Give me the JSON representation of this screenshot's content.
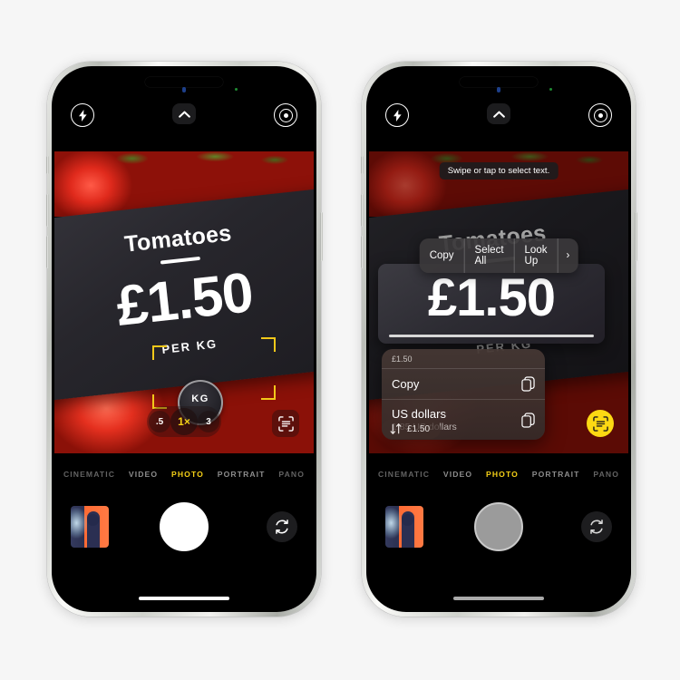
{
  "background_color": "#f6f6f6",
  "accent_yellow": "#f6d117",
  "scan_highlight_color": "#fcd913",
  "bracket_color": "#f2c81a",
  "phones": [
    {
      "id": "left",
      "label": "iphone-camera-live-text",
      "camera_controls": {
        "flash_icon": "flash-icon",
        "chevron_icon": "chevron-up-icon",
        "live_photo_icon": "live-photo-icon"
      },
      "sign": {
        "title": "Tomatoes",
        "price": "£1.50",
        "unit": "PER KG",
        "loupe_text": "KG"
      },
      "zoom_levels": [
        {
          "label": ".5",
          "selected": false
        },
        {
          "label": "1×",
          "selected": true
        },
        {
          "label": "3",
          "selected": false
        }
      ],
      "scan_button": {
        "icon": "live-text-scan-icon",
        "highlighted": false
      },
      "modes": [
        {
          "label": "CINEMATIC",
          "active": false,
          "edge": true
        },
        {
          "label": "VIDEO",
          "active": false,
          "edge": false
        },
        {
          "label": "PHOTO",
          "active": true,
          "edge": false
        },
        {
          "label": "PORTRAIT",
          "active": false,
          "edge": false
        },
        {
          "label": "PANO",
          "active": false,
          "edge": true
        }
      ],
      "shutter": {
        "name": "shutter-button",
        "dimmed": false
      },
      "flip_icon": "camera-flip-icon",
      "thumbnail": "photo-library-thumbnail"
    },
    {
      "id": "right",
      "label": "iphone-live-text-selection",
      "camera_controls": {
        "flash_icon": "flash-icon",
        "chevron_icon": "chevron-up-icon",
        "live_photo_icon": "live-photo-icon"
      },
      "sign": {
        "title": "Tomatoes",
        "price": "£1.50",
        "unit": "PER KG"
      },
      "tooltip": "Swipe or tap to select text.",
      "edit_menu": [
        {
          "label": "Copy"
        },
        {
          "label": "Select All"
        },
        {
          "label": "Look Up"
        },
        {
          "label": "›"
        }
      ],
      "magnifier": {
        "text": "£1.50"
      },
      "context_menu": {
        "header": "£1.50",
        "items": [
          {
            "title": "Copy",
            "subtitle": "",
            "icon": "copy-icon"
          },
          {
            "title": "US dollars",
            "subtitle": "1.85 US dollars",
            "icon": "copy-icon"
          }
        ]
      },
      "conversion_pill": {
        "icon": "convert-arrows-icon",
        "label": "£1.50"
      },
      "scan_button": {
        "icon": "live-text-scan-icon",
        "highlighted": true
      },
      "modes": [
        {
          "label": "CINEMATIC",
          "active": false,
          "edge": true
        },
        {
          "label": "VIDEO",
          "active": false,
          "edge": false
        },
        {
          "label": "PHOTO",
          "active": true,
          "edge": false
        },
        {
          "label": "PORTRAIT",
          "active": false,
          "edge": false
        },
        {
          "label": "PANO",
          "active": false,
          "edge": true
        }
      ],
      "shutter": {
        "name": "shutter-button",
        "dimmed": true
      },
      "flip_icon": "camera-flip-icon",
      "thumbnail": "photo-library-thumbnail"
    }
  ]
}
